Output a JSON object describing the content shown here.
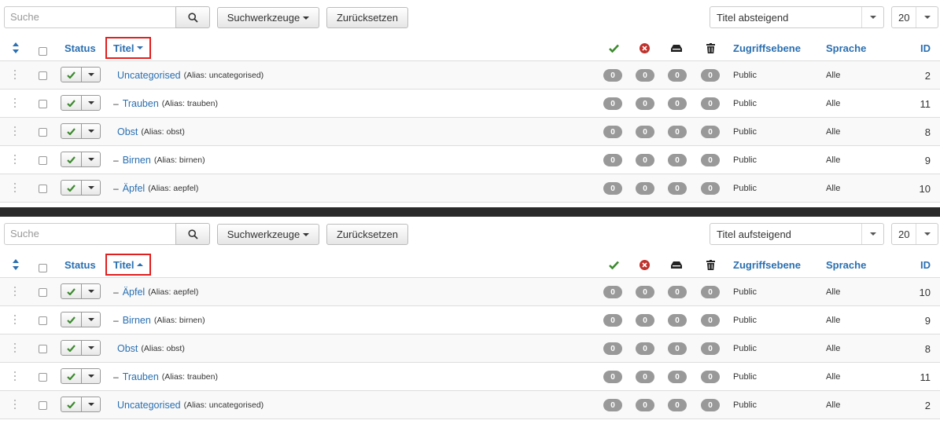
{
  "panels": [
    {
      "search": {
        "placeholder": "Suche"
      },
      "buttons": {
        "search_tools": "Suchwerkzeuge",
        "reset": "Zurücksetzen"
      },
      "ordering": {
        "selected": "Titel absteigend"
      },
      "limit": {
        "selected": "20"
      },
      "headers": {
        "status": "Status",
        "title": "Titel",
        "access": "Zugriffsebene",
        "language": "Sprache",
        "id": "ID"
      },
      "sort_direction": "desc",
      "rows": [
        {
          "dash": "",
          "title": "Uncategorised",
          "alias": "(Alias: uncategorised)",
          "published": "0",
          "unpublished": "0",
          "archived": "0",
          "trashed": "0",
          "access": "Public",
          "language": "Alle",
          "id": "2"
        },
        {
          "dash": "–",
          "title": "Trauben",
          "alias": "(Alias: trauben)",
          "published": "0",
          "unpublished": "0",
          "archived": "0",
          "trashed": "0",
          "access": "Public",
          "language": "Alle",
          "id": "11"
        },
        {
          "dash": "",
          "title": "Obst",
          "alias": "(Alias: obst)",
          "published": "0",
          "unpublished": "0",
          "archived": "0",
          "trashed": "0",
          "access": "Public",
          "language": "Alle",
          "id": "8"
        },
        {
          "dash": "–",
          "title": "Birnen",
          "alias": "(Alias: birnen)",
          "published": "0",
          "unpublished": "0",
          "archived": "0",
          "trashed": "0",
          "access": "Public",
          "language": "Alle",
          "id": "9"
        },
        {
          "dash": "–",
          "title": "Äpfel",
          "alias": "(Alias: aepfel)",
          "published": "0",
          "unpublished": "0",
          "archived": "0",
          "trashed": "0",
          "access": "Public",
          "language": "Alle",
          "id": "10"
        }
      ]
    },
    {
      "search": {
        "placeholder": "Suche"
      },
      "buttons": {
        "search_tools": "Suchwerkzeuge",
        "reset": "Zurücksetzen"
      },
      "ordering": {
        "selected": "Titel aufsteigend"
      },
      "limit": {
        "selected": "20"
      },
      "headers": {
        "status": "Status",
        "title": "Titel",
        "access": "Zugriffsebene",
        "language": "Sprache",
        "id": "ID"
      },
      "sort_direction": "asc",
      "rows": [
        {
          "dash": "–",
          "title": "Äpfel",
          "alias": "(Alias: aepfel)",
          "published": "0",
          "unpublished": "0",
          "archived": "0",
          "trashed": "0",
          "access": "Public",
          "language": "Alle",
          "id": "10"
        },
        {
          "dash": "–",
          "title": "Birnen",
          "alias": "(Alias: birnen)",
          "published": "0",
          "unpublished": "0",
          "archived": "0",
          "trashed": "0",
          "access": "Public",
          "language": "Alle",
          "id": "9"
        },
        {
          "dash": "",
          "title": "Obst",
          "alias": "(Alias: obst)",
          "published": "0",
          "unpublished": "0",
          "archived": "0",
          "trashed": "0",
          "access": "Public",
          "language": "Alle",
          "id": "8"
        },
        {
          "dash": "–",
          "title": "Trauben",
          "alias": "(Alias: trauben)",
          "published": "0",
          "unpublished": "0",
          "archived": "0",
          "trashed": "0",
          "access": "Public",
          "language": "Alle",
          "id": "11"
        },
        {
          "dash": "",
          "title": "Uncategorised",
          "alias": "(Alias: uncategorised)",
          "published": "0",
          "unpublished": "0",
          "archived": "0",
          "trashed": "0",
          "access": "Public",
          "language": "Alle",
          "id": "2"
        }
      ]
    }
  ],
  "icons": {
    "search": "search-icon",
    "published": "check-icon",
    "unpublished": "times-circle-icon",
    "archived": "archive-icon",
    "trashed": "trash-icon",
    "sort": "sort-icon",
    "drag": "drag-handle-icon"
  },
  "colors": {
    "link": "#2a6fb0",
    "published": "#3c8a2e",
    "unpublished": "#c0322c",
    "highlight": "#e02020",
    "badge": "#999999"
  }
}
